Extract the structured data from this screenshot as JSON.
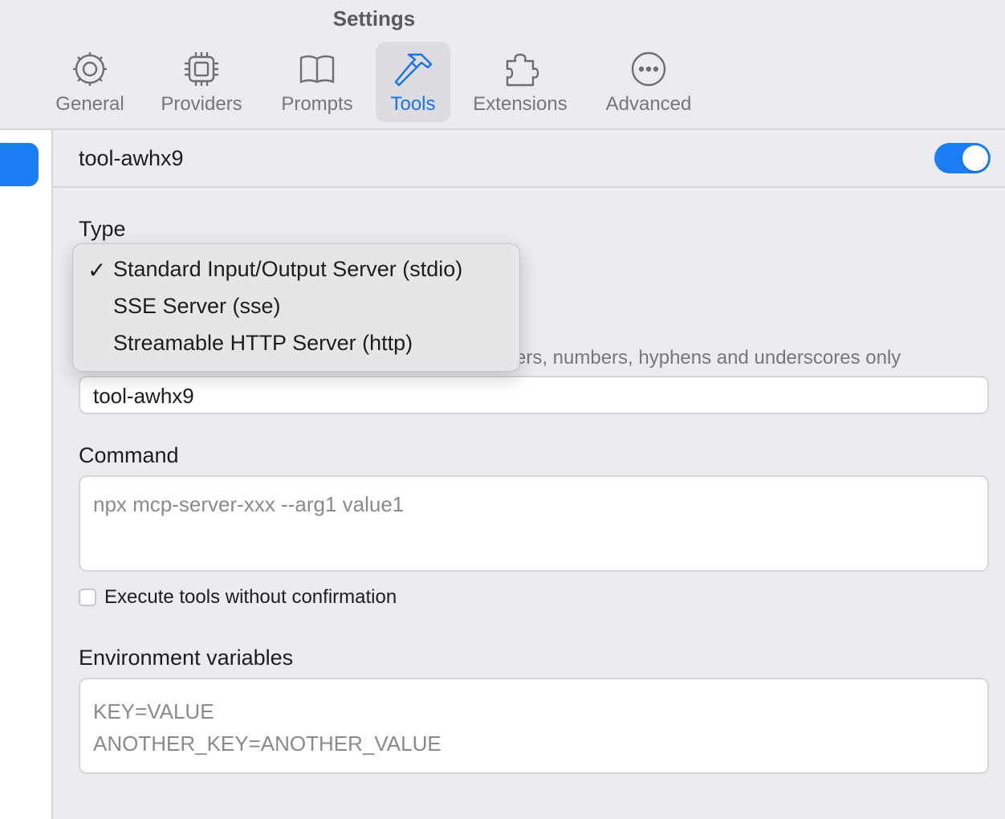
{
  "window": {
    "title": "Settings"
  },
  "toolbar": {
    "tabs": [
      {
        "label": "General",
        "icon": "gear-icon"
      },
      {
        "label": "Providers",
        "icon": "chip-icon"
      },
      {
        "label": "Prompts",
        "icon": "book-icon"
      },
      {
        "label": "Tools",
        "icon": "hammer-icon",
        "active": true
      },
      {
        "label": "Extensions",
        "icon": "puzzle-icon"
      },
      {
        "label": "Advanced",
        "icon": "ellipsis-circle-icon"
      }
    ]
  },
  "tool": {
    "name": "tool-awhx9",
    "enabled": true
  },
  "form": {
    "type_label": "Type",
    "type_options": [
      {
        "label": "Standard Input/Output Server (stdio)",
        "selected": true
      },
      {
        "label": "SSE Server (sse)",
        "selected": false
      },
      {
        "label": "Streamable HTTP Server (http)",
        "selected": false
      }
    ],
    "name_hint_visible": "ers, numbers, hyphens and underscores only",
    "name_value": "tool-awhx9",
    "command_label": "Command",
    "command_placeholder": "npx mcp-server-xxx --arg1 value1",
    "auto_execute_label": "Execute tools without confirmation",
    "auto_execute_checked": false,
    "env_label": "Environment variables",
    "env_placeholder": "KEY=VALUE\nANOTHER_KEY=ANOTHER_VALUE"
  },
  "colors": {
    "accent": "#1a7ef6",
    "active_tab_text": "#1a73e8"
  },
  "check_glyph": "✓"
}
